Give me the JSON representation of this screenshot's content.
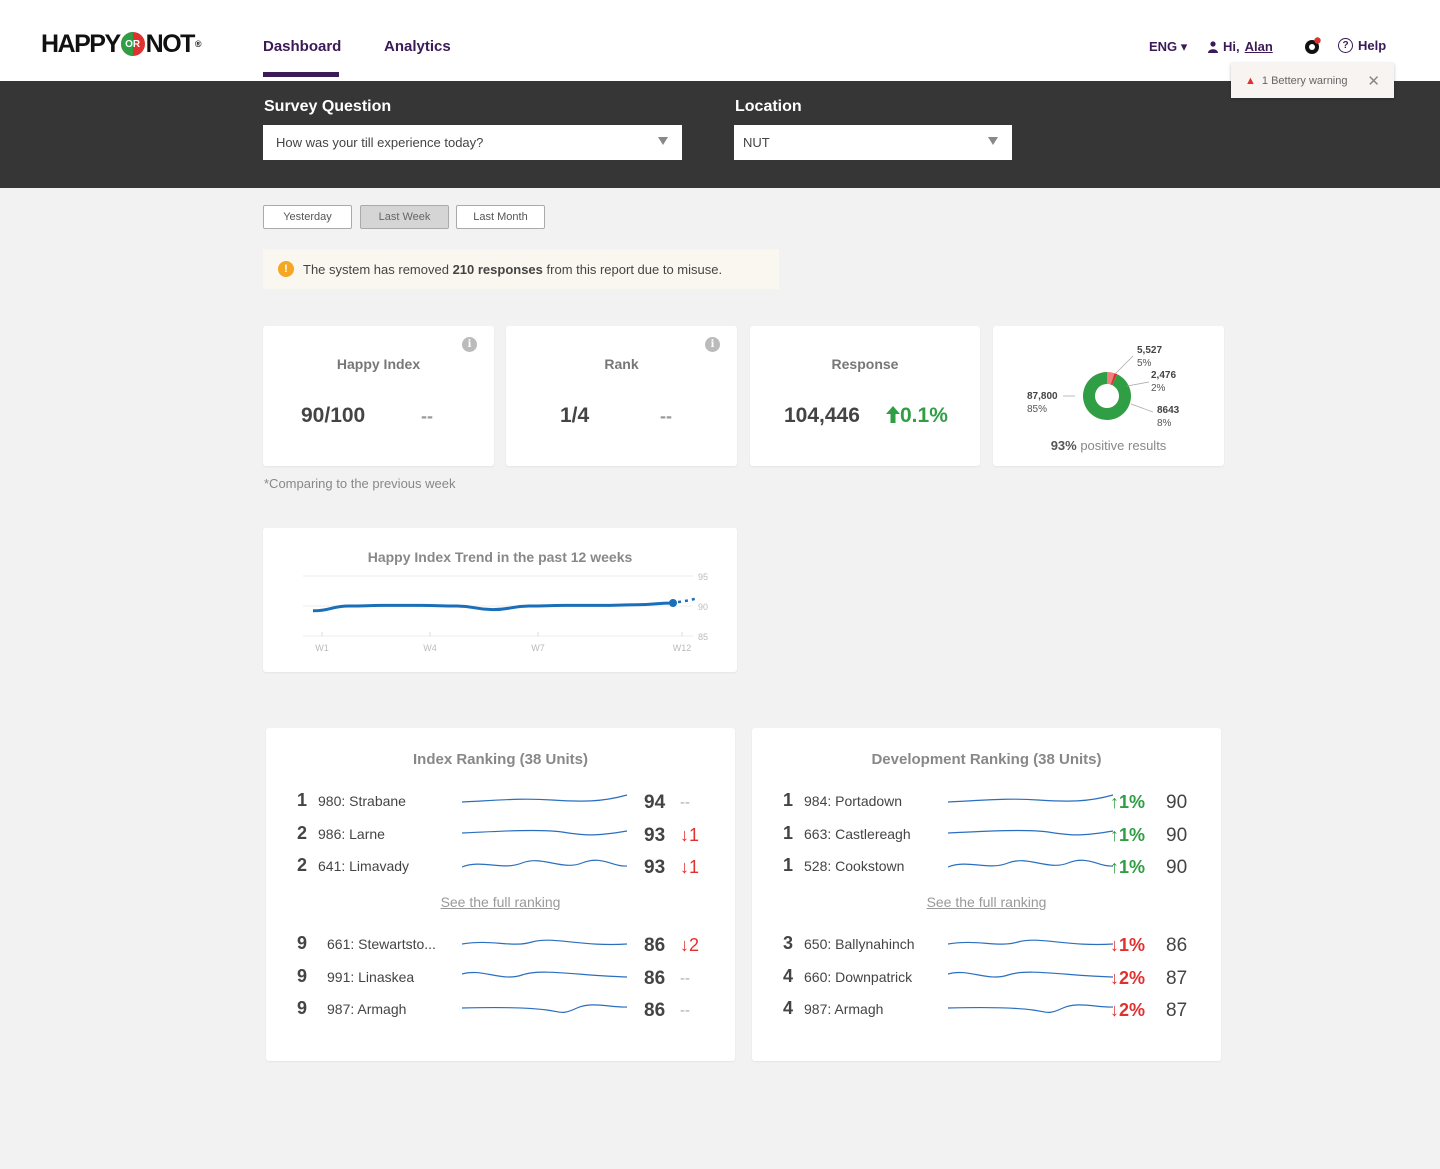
{
  "brand": {
    "left": "HAPPY",
    "or": "OR",
    "right": "NOT",
    "reg": "®"
  },
  "nav": {
    "dashboard": "Dashboard",
    "analytics": "Analytics"
  },
  "header": {
    "lang": "ENG ▾",
    "greeting": "Hi,",
    "user": "Alan",
    "help": "Help"
  },
  "warning": {
    "text": "1 Bettery warning",
    "close": "✕"
  },
  "filters": {
    "question_label": "Survey Question",
    "question_value": "How was your till experience today?",
    "location_label": "Location",
    "location_value": "NUT"
  },
  "periods": [
    "Yesterday",
    "Last Week",
    "Last Month"
  ],
  "active_period": "Last Week",
  "notice": {
    "pre": "The system has removed ",
    "bold": "210 responses",
    "post": " from this report due to misuse."
  },
  "kpis": {
    "happy_index": {
      "title": "Happy Index",
      "value": "90/100",
      "delta": "--"
    },
    "rank": {
      "title": "Rank",
      "value": "1/4",
      "delta": "--"
    },
    "response": {
      "title": "Response",
      "value": "104,446",
      "delta": "0.1%"
    },
    "donut": {
      "segments": [
        {
          "count": "87,800",
          "pct": "85%",
          "share": 85,
          "color": "#2f9e44"
        },
        {
          "count": "5,527",
          "pct": "5%",
          "share": 5,
          "color": "#f08080"
        },
        {
          "count": "2,476",
          "pct": "2%",
          "share": 2,
          "color": "#e03131"
        },
        {
          "count": "8643",
          "pct": "8%",
          "share": 8,
          "color": "#e03131"
        }
      ],
      "positive_bold": "93%",
      "positive_text": " positive results"
    }
  },
  "compare_note": "*Comparing to the previous week",
  "trend": {
    "title": "Happy Index Trend in the past 12 weeks",
    "x_ticks": [
      "W1",
      "W4",
      "W7",
      "W12"
    ],
    "y_ticks": [
      "95",
      "90",
      "85"
    ],
    "ylim": [
      85,
      95
    ],
    "values": [
      89.2,
      90.0,
      90.1,
      90.1,
      90.0,
      89.4,
      90.0,
      90.1,
      90.1,
      90.2,
      90.5,
      91.2
    ]
  },
  "index_ranking": {
    "title": "Index Ranking (38 Units)",
    "see_full": "See the full ranking",
    "top": [
      {
        "pos": "1",
        "name": "980: Strabane",
        "value": "94",
        "delta": "--",
        "dir": "flat"
      },
      {
        "pos": "2",
        "name": "986: Larne",
        "value": "93",
        "delta": "↓1",
        "dir": "down"
      },
      {
        "pos": "2",
        "name": "641:  Limavady",
        "value": "93",
        "delta": "↓1",
        "dir": "down"
      }
    ],
    "bottom": [
      {
        "pos": "9",
        "name": "661: Stewartsto...",
        "value": "86",
        "delta": "↓2",
        "dir": "down"
      },
      {
        "pos": "9",
        "name": "991: Linaskea",
        "value": "86",
        "delta": "--",
        "dir": "flat"
      },
      {
        "pos": "9",
        "name": "987: Armagh",
        "value": "86",
        "delta": "--",
        "dir": "flat"
      }
    ]
  },
  "dev_ranking": {
    "title": "Development Ranking (38 Units)",
    "see_full": "See the full ranking",
    "top": [
      {
        "pos": "1",
        "name": "984: Portadown",
        "delta": "↑1%",
        "value": "90"
      },
      {
        "pos": "1",
        "name": "663: Castlereagh",
        "delta": "↑1%",
        "value": "90"
      },
      {
        "pos": "1",
        "name": "528: Cookstown",
        "delta": "↑1%",
        "value": "90"
      }
    ],
    "bottom": [
      {
        "pos": "3",
        "name": "650: Ballynahinch",
        "delta": "↓1%",
        "value": "86"
      },
      {
        "pos": "4",
        "name": "660: Downpatrick",
        "delta": "↓2%",
        "value": "87"
      },
      {
        "pos": "4",
        "name": "987: Armagh",
        "delta": "↓2%",
        "value": "87"
      }
    ]
  }
}
